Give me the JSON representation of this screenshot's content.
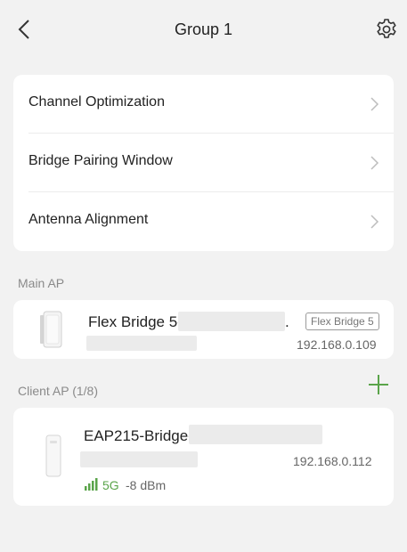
{
  "header": {
    "title": "Group 1",
    "back_icon": "chevron-left-icon",
    "settings_icon": "gear-icon"
  },
  "menu": [
    {
      "label": "Channel Optimization"
    },
    {
      "label": "Bridge Pairing Window"
    },
    {
      "label": "Antenna Alignment"
    }
  ],
  "main_ap": {
    "section_label": "Main AP",
    "name": "Flex Bridge 5-",
    "name_suffix": ".",
    "model": "Flex Bridge 5",
    "ip": "192.168.0.109"
  },
  "client_ap": {
    "section_label": "Client AP (1/8)",
    "add_icon": "plus-icon",
    "name": "EAP215-Bridge-",
    "ip": "192.168.0.112",
    "band": "5G",
    "signal": "-8 dBm"
  },
  "colors": {
    "accent": "#5aa44a",
    "background": "#f2f2f2",
    "card": "#ffffff"
  }
}
